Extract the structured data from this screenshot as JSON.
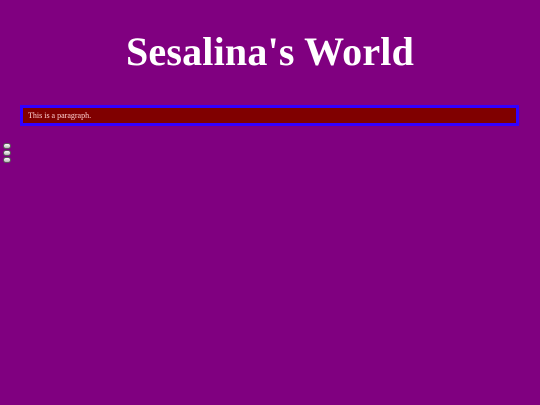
{
  "page": {
    "title": "Sesalina's World",
    "paragraph": "This is a paragraph."
  },
  "colors": {
    "background": "#800080",
    "title_text": "#ffffff",
    "box_background": "#800000",
    "box_border": "#3300ff",
    "paragraph_text": "#ffd1d1"
  },
  "icons": {
    "side_widgets": [
      "play-button-icon",
      "play-button-icon",
      "play-button-icon"
    ]
  }
}
